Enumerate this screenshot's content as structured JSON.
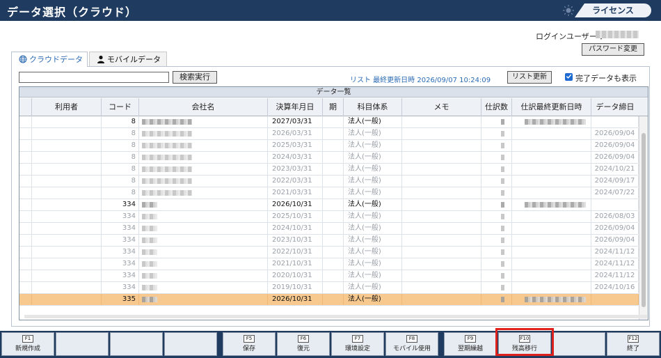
{
  "title": "データ選択（クラウド）",
  "license_button": "ライセンス",
  "login": {
    "label": "ログインユーザー ：",
    "password_button": "パスワード変更"
  },
  "tabs": [
    {
      "label": "クラウドデータ"
    },
    {
      "label": "モバイルデータ"
    }
  ],
  "toolbar": {
    "search_value": "",
    "search_button": "検索実行",
    "list_updated": "リスト 最終更新日時 2026/09/07 10:24:09",
    "refresh_button": "リスト更新",
    "show_completed": "完了データも表示"
  },
  "grid": {
    "title": "データ一覧",
    "columns": [
      "",
      "利用者",
      "コード",
      "会社名",
      "決算年月日",
      "期",
      "科目体系",
      "メモ",
      "仕訳数",
      "仕訳最終更新日時",
      "データ締日"
    ],
    "rows": [
      {
        "code": "8",
        "date": "2027/03/31",
        "system": "法人(一般)",
        "closed": "",
        "state": "active"
      },
      {
        "code": "8",
        "date": "2026/03/31",
        "system": "法人(一般)",
        "closed": "2026/09/04",
        "state": "old"
      },
      {
        "code": "8",
        "date": "2025/03/31",
        "system": "法人(一般)",
        "closed": "2026/09/04",
        "state": "old"
      },
      {
        "code": "8",
        "date": "2024/03/31",
        "system": "法人(一般)",
        "closed": "2026/09/04",
        "state": "old"
      },
      {
        "code": "8",
        "date": "2023/03/31",
        "system": "法人(一般)",
        "closed": "2024/10/21",
        "state": "old"
      },
      {
        "code": "8",
        "date": "2022/03/31",
        "system": "法人(一般)",
        "closed": "2024/09/17",
        "state": "old"
      },
      {
        "code": "8",
        "date": "2021/03/31",
        "system": "法人(一般)",
        "closed": "2024/07/22",
        "state": "old"
      },
      {
        "code": "334",
        "date": "2026/10/31",
        "system": "法人(一般)",
        "closed": "",
        "state": "active"
      },
      {
        "code": "334",
        "date": "2025/10/31",
        "system": "法人(一般)",
        "closed": "2026/08/03",
        "state": "old"
      },
      {
        "code": "334",
        "date": "2024/10/31",
        "system": "法人(一般)",
        "closed": "2026/09/04",
        "state": "old"
      },
      {
        "code": "334",
        "date": "2023/10/31",
        "system": "法人(一般)",
        "closed": "2026/09/04",
        "state": "old"
      },
      {
        "code": "334",
        "date": "2022/10/31",
        "system": "法人(一般)",
        "closed": "2024/11/12",
        "state": "old"
      },
      {
        "code": "334",
        "date": "2021/10/31",
        "system": "法人(一般)",
        "closed": "2024/11/12",
        "state": "old"
      },
      {
        "code": "334",
        "date": "2020/10/31",
        "system": "法人(一般)",
        "closed": "2024/11/12",
        "state": "old"
      },
      {
        "code": "334",
        "date": "2019/10/31",
        "system": "法人(一般)",
        "closed": "2024/10/16",
        "state": "old"
      },
      {
        "code": "335",
        "date": "2026/10/31",
        "system": "法人(一般)",
        "closed": "",
        "state": "sel"
      }
    ]
  },
  "fkeys": [
    {
      "key": "F1",
      "label": "新規作成"
    },
    {
      "key": "",
      "label": ""
    },
    {
      "key": "",
      "label": ""
    },
    {
      "key": "",
      "label": ""
    },
    {
      "key": "F5",
      "label": "保存"
    },
    {
      "key": "F6",
      "label": "復元"
    },
    {
      "key": "F7",
      "label": "環境設定"
    },
    {
      "key": "F8",
      "label": "モバイル使用"
    },
    {
      "key": "F9",
      "label": "翌期繰越"
    },
    {
      "key": "F10",
      "label": "残高移行"
    },
    {
      "key": "",
      "label": ""
    },
    {
      "key": "F12",
      "label": "終了"
    }
  ],
  "colors": {
    "titlebar": "#1f3b60",
    "accent": "#2c6bb4",
    "selected_row": "#f7c98f",
    "highlight": "#e0201a"
  }
}
